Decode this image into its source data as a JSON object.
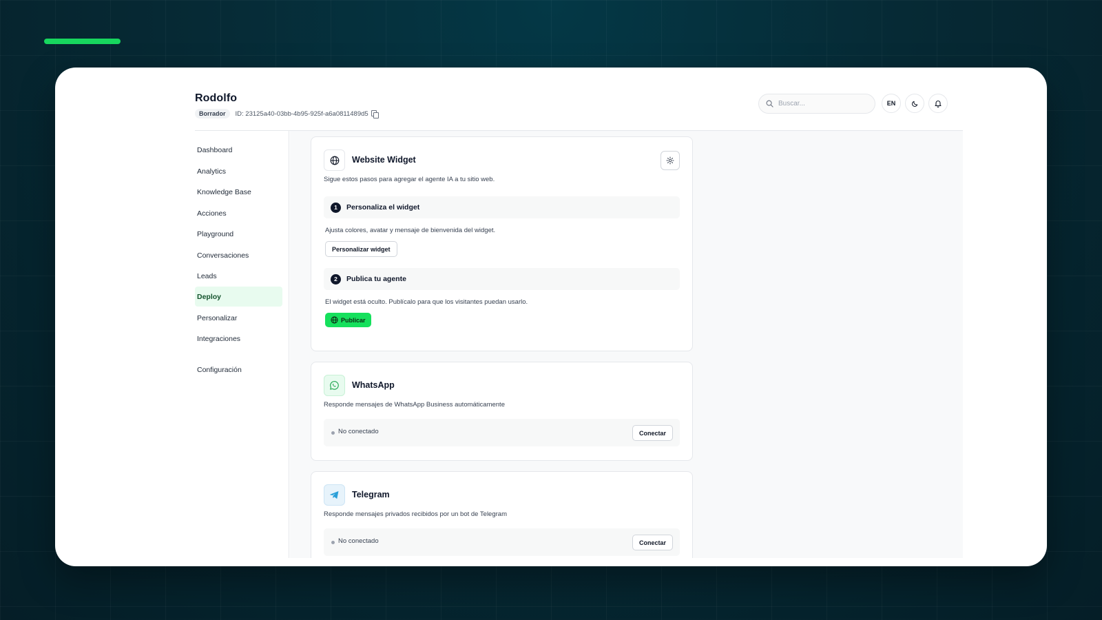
{
  "agent": {
    "name": "Rodolfo",
    "status": "Borrador",
    "id_label": "ID: 23125a40-03bb-4b95-925f-a6a0811489d5"
  },
  "header": {
    "search_placeholder": "Buscar...",
    "language": "EN"
  },
  "sidebar": {
    "items": [
      {
        "label": "Dashboard"
      },
      {
        "label": "Analytics"
      },
      {
        "label": "Knowledge Base"
      },
      {
        "label": "Acciones"
      },
      {
        "label": "Playground"
      },
      {
        "label": "Conversaciones"
      },
      {
        "label": "Leads"
      },
      {
        "label": "Deploy"
      },
      {
        "label": "Personalizar"
      },
      {
        "label": "Integraciones"
      },
      {
        "label": "Configuración"
      }
    ],
    "active": "Deploy"
  },
  "widget_card": {
    "title": "Website Widget",
    "description": "Sigue estos pasos para agregar el agente IA a tu sitio web.",
    "step1": {
      "number": "1",
      "title": "Personaliza el widget",
      "description": "Ajusta colores, avatar y mensaje de bienvenida del widget.",
      "button": "Personalizar widget"
    },
    "step2": {
      "number": "2",
      "title": "Publica tu agente",
      "description": "El widget está oculto. Publícalo para que los visitantes puedan usarlo.",
      "button": "Publicar"
    }
  },
  "whatsapp_card": {
    "title": "WhatsApp",
    "description": "Responde mensajes de WhatsApp Business automáticamente",
    "status": "No conectado",
    "button": "Conectar"
  },
  "telegram_card": {
    "title": "Telegram",
    "description": "Responde mensajes privados recibidos por un bot de Telegram",
    "status": "No conectado",
    "button": "Conectar"
  },
  "colors": {
    "accent": "#17d65e",
    "publish": "#15e05c",
    "active_nav_bg": "#e8fbef",
    "background": "#062a35"
  }
}
